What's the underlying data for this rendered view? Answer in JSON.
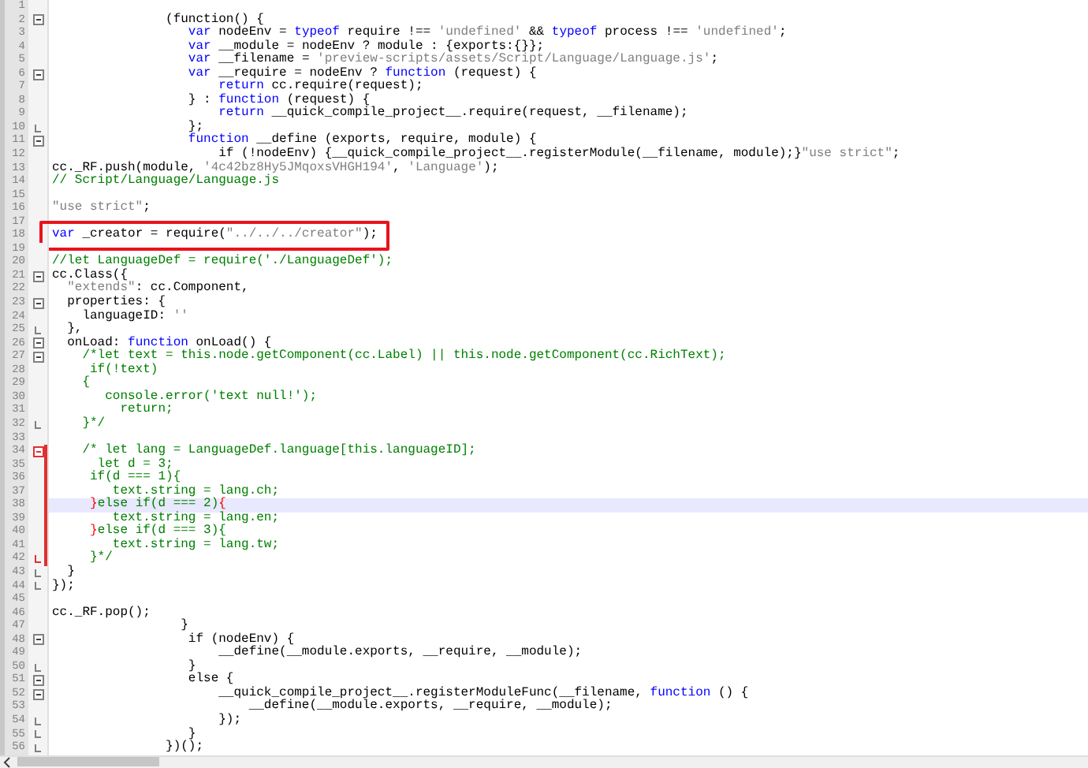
{
  "editor": {
    "lines": [
      {
        "number": "1",
        "fold_start": false,
        "fold_end": false,
        "changed": false,
        "current": false
      },
      {
        "number": "2",
        "fold_start": true,
        "fold_end": false,
        "changed": false,
        "current": false,
        "boxed": false,
        "tokens": [
          {
            "kind": "plain",
            "text": "               (function() {"
          }
        ]
      },
      {
        "number": "3",
        "fold_start": false,
        "fold_end": false,
        "changed": false,
        "current": false,
        "boxed": false,
        "tokens": [
          {
            "kind": "keyword",
            "text": "                  var"
          },
          {
            "kind": "plain",
            "text": " nodeEnv = "
          },
          {
            "kind": "keyword",
            "text": "typeof"
          },
          {
            "kind": "plain",
            "text": " require !== "
          },
          {
            "kind": "string",
            "text": "'undefined'"
          },
          {
            "kind": "plain",
            "text": " && "
          },
          {
            "kind": "keyword",
            "text": "typeof"
          },
          {
            "kind": "plain",
            "text": " process !== "
          },
          {
            "kind": "string",
            "text": "'undefined'"
          },
          {
            "kind": "plain",
            "text": ";"
          }
        ]
      },
      {
        "number": "4",
        "fold_start": false,
        "fold_end": false,
        "changed": false,
        "current": false,
        "boxed": false,
        "tokens": [
          {
            "kind": "keyword",
            "text": "                  var"
          },
          {
            "kind": "plain",
            "text": " __module = nodeEnv ? module : {exports:{}};"
          }
        ]
      },
      {
        "number": "5",
        "fold_start": false,
        "fold_end": false,
        "changed": false,
        "current": false,
        "boxed": false,
        "tokens": [
          {
            "kind": "keyword",
            "text": "                  var"
          },
          {
            "kind": "plain",
            "text": " __filename = "
          },
          {
            "kind": "string",
            "text": "'preview-scripts/assets/Script/Language/Language.js'"
          },
          {
            "kind": "plain",
            "text": ";"
          }
        ]
      },
      {
        "number": "6",
        "fold_start": true,
        "fold_end": false,
        "changed": false,
        "current": false,
        "boxed": false,
        "tokens": [
          {
            "kind": "keyword",
            "text": "                  var"
          },
          {
            "kind": "plain",
            "text": " __require = nodeEnv ? "
          },
          {
            "kind": "keyword",
            "text": "function"
          },
          {
            "kind": "plain",
            "text": " (request) {"
          }
        ]
      },
      {
        "number": "7",
        "fold_start": false,
        "fold_end": false,
        "changed": false,
        "current": false,
        "boxed": false,
        "tokens": [
          {
            "kind": "keyword",
            "text": "                      return"
          },
          {
            "kind": "plain",
            "text": " cc.require(request);"
          }
        ]
      },
      {
        "number": "8",
        "fold_start": false,
        "fold_end": false,
        "changed": false,
        "current": false,
        "boxed": false,
        "tokens": [
          {
            "kind": "plain",
            "text": "                  } : "
          },
          {
            "kind": "keyword",
            "text": "function"
          },
          {
            "kind": "plain",
            "text": " (request) {"
          }
        ]
      },
      {
        "number": "9",
        "fold_start": false,
        "fold_end": false,
        "changed": false,
        "current": false,
        "boxed": false,
        "tokens": [
          {
            "kind": "keyword",
            "text": "                      return"
          },
          {
            "kind": "plain",
            "text": " __quick_compile_project__.require(request, __filename);"
          }
        ]
      },
      {
        "number": "10",
        "fold_start": false,
        "fold_end": true,
        "changed": false,
        "current": false,
        "boxed": false,
        "tokens": [
          {
            "kind": "plain",
            "text": "                  };"
          }
        ]
      },
      {
        "number": "11",
        "fold_start": true,
        "fold_end": false,
        "changed": false,
        "current": false,
        "boxed": false,
        "tokens": [
          {
            "kind": "keyword",
            "text": "                  function"
          },
          {
            "kind": "plain",
            "text": " __define (exports, require, module) {"
          }
        ]
      },
      {
        "number": "12",
        "fold_start": false,
        "fold_end": false,
        "changed": false,
        "current": false,
        "boxed": false,
        "tokens": [
          {
            "kind": "plain",
            "text": "                      if (!nodeEnv) {__quick_compile_project__.registerModule(__filename, module);}"
          },
          {
            "kind": "string",
            "text": "\"use strict\""
          },
          {
            "kind": "plain",
            "text": ";"
          }
        ]
      },
      {
        "number": "13",
        "fold_start": false,
        "fold_end": false,
        "changed": false,
        "current": false,
        "boxed": false,
        "tokens": [
          {
            "kind": "plain",
            "text": "cc._RF.push(module, "
          },
          {
            "kind": "string",
            "text": "'4c42bz8Hy5JMqoxsVHGH194'"
          },
          {
            "kind": "plain",
            "text": ", "
          },
          {
            "kind": "string",
            "text": "'Language'"
          },
          {
            "kind": "plain",
            "text": ");"
          }
        ]
      },
      {
        "number": "14",
        "fold_start": false,
        "fold_end": false,
        "changed": false,
        "current": false,
        "boxed": false,
        "tokens": [
          {
            "kind": "comment",
            "text": "// Script/Language/Language.js"
          }
        ]
      },
      {
        "number": "15",
        "fold_start": false,
        "fold_end": false,
        "changed": false,
        "current": false
      },
      {
        "number": "16",
        "fold_start": false,
        "fold_end": false,
        "changed": false,
        "current": false,
        "boxed": false,
        "tokens": [
          {
            "kind": "string",
            "text": "\"use strict\""
          },
          {
            "kind": "plain",
            "text": ";"
          }
        ]
      },
      {
        "number": "17",
        "fold_start": false,
        "fold_end": false,
        "changed": false,
        "current": false
      },
      {
        "number": "18",
        "fold_start": false,
        "fold_end": false,
        "changed": false,
        "current": false,
        "boxed": true,
        "tokens": [
          {
            "kind": "keyword",
            "text": "var"
          },
          {
            "kind": "plain",
            "text": " _creator = require("
          },
          {
            "kind": "string",
            "text": "\"../../../creator\""
          },
          {
            "kind": "plain",
            "text": ");"
          }
        ]
      },
      {
        "number": "19",
        "fold_start": false,
        "fold_end": false,
        "changed": false,
        "current": false
      },
      {
        "number": "20",
        "fold_start": false,
        "fold_end": false,
        "changed": false,
        "current": false,
        "boxed": false,
        "tokens": [
          {
            "kind": "comment",
            "text": "//let LanguageDef = require('./LanguageDef');"
          }
        ]
      },
      {
        "number": "21",
        "fold_start": true,
        "fold_end": false,
        "changed": false,
        "current": false,
        "boxed": false,
        "tokens": [
          {
            "kind": "plain",
            "text": "cc.Class({"
          }
        ]
      },
      {
        "number": "22",
        "fold_start": false,
        "fold_end": false,
        "changed": false,
        "current": false,
        "boxed": false,
        "tokens": [
          {
            "kind": "string",
            "text": "  \"extends\""
          },
          {
            "kind": "plain",
            "text": ": cc.Component,"
          }
        ]
      },
      {
        "number": "23",
        "fold_start": true,
        "fold_end": false,
        "changed": false,
        "current": false,
        "boxed": false,
        "tokens": [
          {
            "kind": "plain",
            "text": "  properties: {"
          }
        ]
      },
      {
        "number": "24",
        "fold_start": false,
        "fold_end": false,
        "changed": false,
        "current": false,
        "boxed": false,
        "tokens": [
          {
            "kind": "plain",
            "text": "    languageID: "
          },
          {
            "kind": "string",
            "text": "''"
          }
        ]
      },
      {
        "number": "25",
        "fold_start": false,
        "fold_end": true,
        "changed": false,
        "current": false,
        "boxed": false,
        "tokens": [
          {
            "kind": "plain",
            "text": "  },"
          }
        ]
      },
      {
        "number": "26",
        "fold_start": true,
        "fold_end": false,
        "changed": false,
        "current": false,
        "boxed": false,
        "tokens": [
          {
            "kind": "plain",
            "text": "  onLoad: "
          },
          {
            "kind": "keyword",
            "text": "function"
          },
          {
            "kind": "plain",
            "text": " onLoad() {"
          }
        ]
      },
      {
        "number": "27",
        "fold_start": true,
        "fold_end": false,
        "changed": false,
        "current": false,
        "boxed": false,
        "tokens": [
          {
            "kind": "comment",
            "text": "    /*let text = this.node.getComponent(cc.Label) || this.node.getComponent(cc.RichText);"
          }
        ]
      },
      {
        "number": "28",
        "fold_start": false,
        "fold_end": false,
        "changed": false,
        "current": false,
        "boxed": false,
        "tokens": [
          {
            "kind": "comment",
            "text": "     if(!text)"
          }
        ]
      },
      {
        "number": "29",
        "fold_start": false,
        "fold_end": false,
        "changed": false,
        "current": false,
        "boxed": false,
        "tokens": [
          {
            "kind": "comment",
            "text": "    {"
          }
        ]
      },
      {
        "number": "30",
        "fold_start": false,
        "fold_end": false,
        "changed": false,
        "current": false,
        "boxed": false,
        "tokens": [
          {
            "kind": "comment",
            "text": "       console.error('text null!');"
          }
        ]
      },
      {
        "number": "31",
        "fold_start": false,
        "fold_end": false,
        "changed": false,
        "current": false,
        "boxed": false,
        "tokens": [
          {
            "kind": "comment",
            "text": "         return;"
          }
        ]
      },
      {
        "number": "32",
        "fold_start": false,
        "fold_end": true,
        "changed": false,
        "current": false,
        "boxed": false,
        "tokens": [
          {
            "kind": "comment",
            "text": "    }*/"
          }
        ]
      },
      {
        "number": "33",
        "fold_start": false,
        "fold_end": false,
        "changed": false,
        "current": false
      },
      {
        "number": "34",
        "fold_start": true,
        "fold_end": false,
        "changed": true,
        "current": false,
        "boxed": false,
        "tokens": [
          {
            "kind": "comment",
            "text": "    /* let lang = LanguageDef.language[this.languageID];"
          }
        ]
      },
      {
        "number": "35",
        "fold_start": false,
        "fold_end": false,
        "changed": true,
        "current": false,
        "boxed": false,
        "tokens": [
          {
            "kind": "comment",
            "text": "      let d = 3;"
          }
        ]
      },
      {
        "number": "36",
        "fold_start": false,
        "fold_end": false,
        "changed": true,
        "current": false,
        "boxed": false,
        "tokens": [
          {
            "kind": "comment",
            "text": "     if(d === 1){"
          }
        ]
      },
      {
        "number": "37",
        "fold_start": false,
        "fold_end": false,
        "changed": true,
        "current": false,
        "boxed": false,
        "tokens": [
          {
            "kind": "comment",
            "text": "        text.string = lang.ch;"
          }
        ]
      },
      {
        "number": "38",
        "fold_start": false,
        "fold_end": false,
        "changed": true,
        "current": true,
        "boxed": false,
        "tokens": [
          {
            "kind": "match",
            "text": "     }"
          },
          {
            "kind": "comment",
            "text": "else if(d === 2)"
          },
          {
            "kind": "match",
            "text": "{"
          }
        ]
      },
      {
        "number": "39",
        "fold_start": false,
        "fold_end": false,
        "changed": true,
        "current": false,
        "boxed": false,
        "tokens": [
          {
            "kind": "comment",
            "text": "        text.string = lang.en;"
          }
        ]
      },
      {
        "number": "40",
        "fold_start": false,
        "fold_end": false,
        "changed": true,
        "current": false,
        "boxed": false,
        "tokens": [
          {
            "kind": "match",
            "text": "     }"
          },
          {
            "kind": "comment",
            "text": "else if(d === 3){"
          }
        ]
      },
      {
        "number": "41",
        "fold_start": false,
        "fold_end": false,
        "changed": true,
        "current": false,
        "boxed": false,
        "tokens": [
          {
            "kind": "comment",
            "text": "        text.string = lang.tw;"
          }
        ]
      },
      {
        "number": "42",
        "fold_start": false,
        "fold_end": true,
        "changed": true,
        "current": false,
        "boxed": false,
        "tokens": [
          {
            "kind": "comment",
            "text": "     }*/"
          }
        ]
      },
      {
        "number": "43",
        "fold_start": false,
        "fold_end": true,
        "changed": false,
        "current": false,
        "boxed": false,
        "tokens": [
          {
            "kind": "plain",
            "text": "  }"
          }
        ]
      },
      {
        "number": "44",
        "fold_start": false,
        "fold_end": true,
        "changed": false,
        "current": false,
        "boxed": false,
        "tokens": [
          {
            "kind": "plain",
            "text": "});"
          }
        ]
      },
      {
        "number": "45",
        "fold_start": false,
        "fold_end": false,
        "changed": false,
        "current": false
      },
      {
        "number": "46",
        "fold_start": false,
        "fold_end": false,
        "changed": false,
        "current": false,
        "boxed": false,
        "tokens": [
          {
            "kind": "plain",
            "text": "cc._RF.pop();"
          }
        ]
      },
      {
        "number": "47",
        "fold_start": false,
        "fold_end": false,
        "changed": false,
        "current": false,
        "boxed": false,
        "tokens": [
          {
            "kind": "plain",
            "text": "                 }"
          }
        ]
      },
      {
        "number": "48",
        "fold_start": true,
        "fold_end": false,
        "changed": false,
        "current": false,
        "boxed": false,
        "tokens": [
          {
            "kind": "plain",
            "text": "                  if (nodeEnv) {"
          }
        ]
      },
      {
        "number": "49",
        "fold_start": false,
        "fold_end": false,
        "changed": false,
        "current": false,
        "boxed": false,
        "tokens": [
          {
            "kind": "plain",
            "text": "                      __define(__module.exports, __require, __module);"
          }
        ]
      },
      {
        "number": "50",
        "fold_start": false,
        "fold_end": true,
        "changed": false,
        "current": false,
        "boxed": false,
        "tokens": [
          {
            "kind": "plain",
            "text": "                  }"
          }
        ]
      },
      {
        "number": "51",
        "fold_start": true,
        "fold_end": false,
        "changed": false,
        "current": false,
        "boxed": false,
        "tokens": [
          {
            "kind": "plain",
            "text": "                  else {"
          }
        ]
      },
      {
        "number": "52",
        "fold_start": true,
        "fold_end": false,
        "changed": false,
        "current": false,
        "boxed": false,
        "tokens": [
          {
            "kind": "plain",
            "text": "                      __quick_compile_project__.registerModuleFunc(__filename, "
          },
          {
            "kind": "keyword",
            "text": "function"
          },
          {
            "kind": "plain",
            "text": " () {"
          }
        ]
      },
      {
        "number": "53",
        "fold_start": false,
        "fold_end": false,
        "changed": false,
        "current": false,
        "boxed": false,
        "tokens": [
          {
            "kind": "plain",
            "text": "                          __define(__module.exports, __require, __module);"
          }
        ]
      },
      {
        "number": "54",
        "fold_start": false,
        "fold_end": true,
        "changed": false,
        "current": false,
        "boxed": false,
        "tokens": [
          {
            "kind": "plain",
            "text": "                      });"
          }
        ]
      },
      {
        "number": "55",
        "fold_start": false,
        "fold_end": true,
        "changed": false,
        "current": false,
        "boxed": false,
        "tokens": [
          {
            "kind": "plain",
            "text": "                  }"
          }
        ]
      },
      {
        "number": "56",
        "fold_start": false,
        "fold_end": true,
        "changed": false,
        "current": false,
        "boxed": false,
        "tokens": [
          {
            "kind": "plain",
            "text": "               })();"
          }
        ]
      }
    ]
  }
}
